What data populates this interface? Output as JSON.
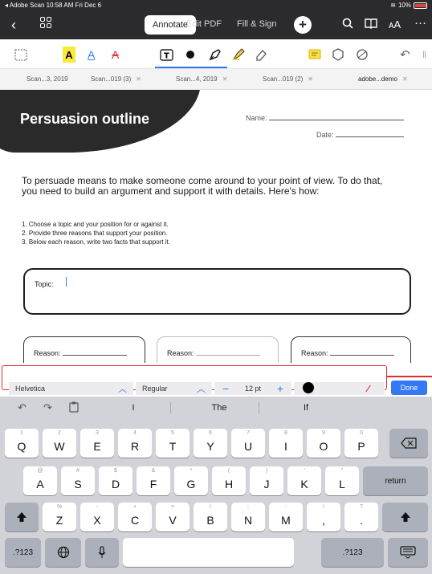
{
  "status": {
    "left": "◂ Adobe Scan  10:58 AM  Fri Dec 6",
    "battery": "10%"
  },
  "nav": {
    "tabs": [
      "Annotate",
      "Edit PDF",
      "Fill & Sign"
    ],
    "text_size_icon": "ᴀA"
  },
  "doc_tabs": [
    "Scan...3, 2019",
    "Scan...019 (3)",
    "Scan...4, 2019",
    "Scan...019 (2)",
    "adobe...demo"
  ],
  "doc": {
    "title": "Persuasion outline",
    "name_label": "Name:",
    "date_label": "Date:",
    "intro": "To persuade means to make someone come around to your point of view. To do that, you need to build an argument and support it with details. Here's how:",
    "steps": [
      "1.  Choose a topic and your position for or against it.",
      "2.  Provide three reasons that support your position.",
      "3.  Below each reason, write two facts that support it."
    ],
    "topic_label": "Topic:",
    "reason_label": "Reason:"
  },
  "format": {
    "font": "Helvetica",
    "style": "Regular",
    "size": "12 pt",
    "done": "Done"
  },
  "keyboard": {
    "suggestions": [
      "I",
      "The",
      "If"
    ],
    "row1": [
      [
        "1",
        "Q"
      ],
      [
        "2",
        "W"
      ],
      [
        "3",
        "E"
      ],
      [
        "4",
        "R"
      ],
      [
        "5",
        "T"
      ],
      [
        "6",
        "Y"
      ],
      [
        "7",
        "U"
      ],
      [
        "8",
        "I"
      ],
      [
        "9",
        "O"
      ],
      [
        "0",
        "P"
      ]
    ],
    "row2": [
      [
        "@",
        "A"
      ],
      [
        "#",
        "S"
      ],
      [
        "$",
        "D"
      ],
      [
        "&",
        "F"
      ],
      [
        "*",
        "G"
      ],
      [
        "(",
        "H"
      ],
      [
        ")",
        "J"
      ],
      [
        "'",
        "K"
      ],
      [
        "\"",
        "L"
      ]
    ],
    "row3": [
      [
        "%",
        "Z"
      ],
      [
        "-",
        "X"
      ],
      [
        "+",
        "C"
      ],
      [
        "=",
        "V"
      ],
      [
        "/",
        "B"
      ],
      [
        ";",
        "N"
      ],
      [
        ":",
        "M"
      ],
      [
        "!",
        ","
      ],
      [
        "?",
        "."
      ]
    ],
    "return": "return",
    "numbers": ".?123"
  }
}
